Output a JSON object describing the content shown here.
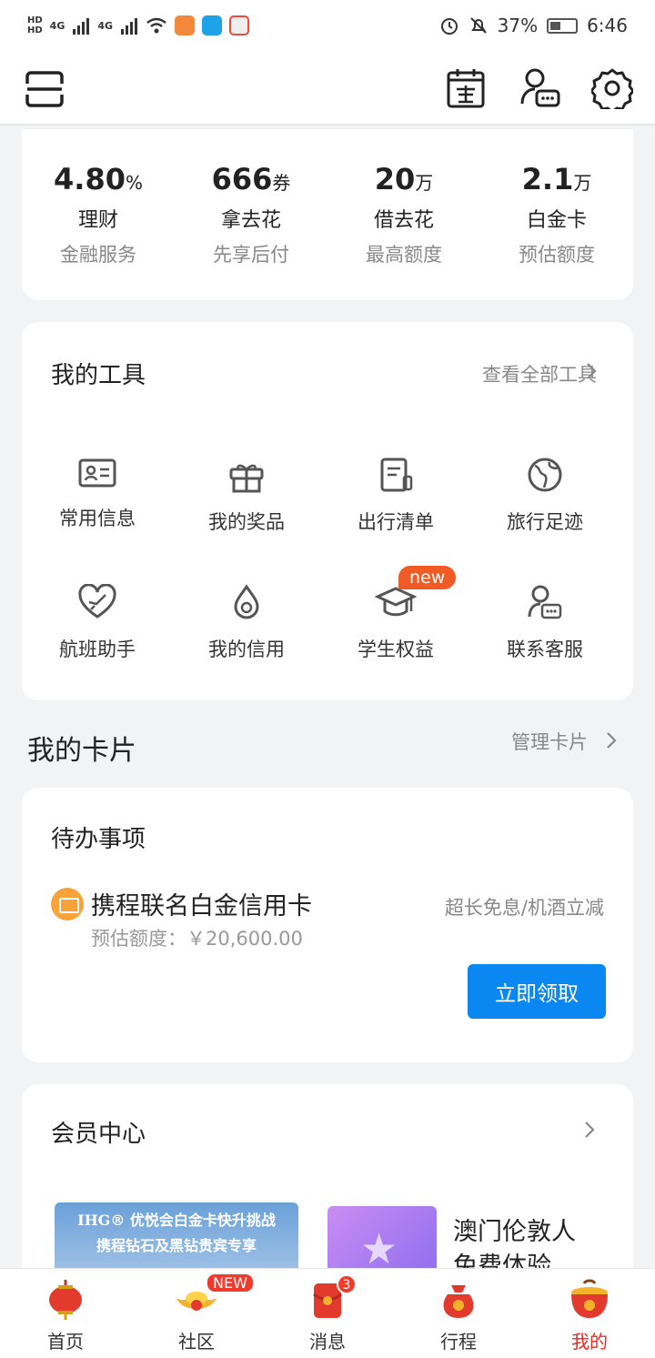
{
  "status_bar": {
    "hd1": "HD",
    "hd2": "HD",
    "signal1": "4G",
    "signal2": "4G",
    "battery": "37%",
    "time": "6:46"
  },
  "financial": [
    {
      "value": "4.80",
      "unit": "%",
      "name": "理财",
      "sub": "金融服务"
    },
    {
      "value": "666",
      "unit": "券",
      "name": "拿去花",
      "sub": "先享后付"
    },
    {
      "value": "20",
      "unit": "万",
      "name": "借去花",
      "sub": "最高额度"
    },
    {
      "value": "2.1",
      "unit": "万",
      "name": "白金卡",
      "sub": "预估额度"
    }
  ],
  "tools": {
    "title": "我的工具",
    "link": "查看全部工具",
    "items": [
      {
        "label": "常用信息",
        "icon": "id-card-icon"
      },
      {
        "label": "我的奖品",
        "icon": "gift-icon"
      },
      {
        "label": "出行清单",
        "icon": "checklist-icon"
      },
      {
        "label": "旅行足迹",
        "icon": "globe-icon"
      },
      {
        "label": "航班助手",
        "icon": "flight-heart-icon"
      },
      {
        "label": "我的信用",
        "icon": "credit-drop-icon"
      },
      {
        "label": "学生权益",
        "icon": "graduation-cap-icon",
        "badge": "new"
      },
      {
        "label": "联系客服",
        "icon": "customer-service-icon"
      }
    ]
  },
  "cards": {
    "title": "我的卡片",
    "link": "管理卡片"
  },
  "todo": {
    "title": "待办事项",
    "name": "携程联名白金信用卡",
    "perk": "超长免息/机酒立减",
    "sub": "预估额度：￥20,600.00",
    "button": "立即领取"
  },
  "member": {
    "title": "会员中心",
    "promo1_line1": "IHG® 优悦会白金卡快升挑战",
    "promo1_line2": "携程钻石及黑钻贵宾专享",
    "promo2_line1": "澳门伦敦人",
    "promo2_line2": "免费体验"
  },
  "tabbar": [
    {
      "label": "首页"
    },
    {
      "label": "社区",
      "badge": "NEW"
    },
    {
      "label": "消息",
      "badge": "3"
    },
    {
      "label": "行程"
    },
    {
      "label": "我的",
      "active": true
    }
  ],
  "colors": {
    "accent": "#0a87f0",
    "active_tab": "#e02e24",
    "badge": "#f05a24"
  }
}
